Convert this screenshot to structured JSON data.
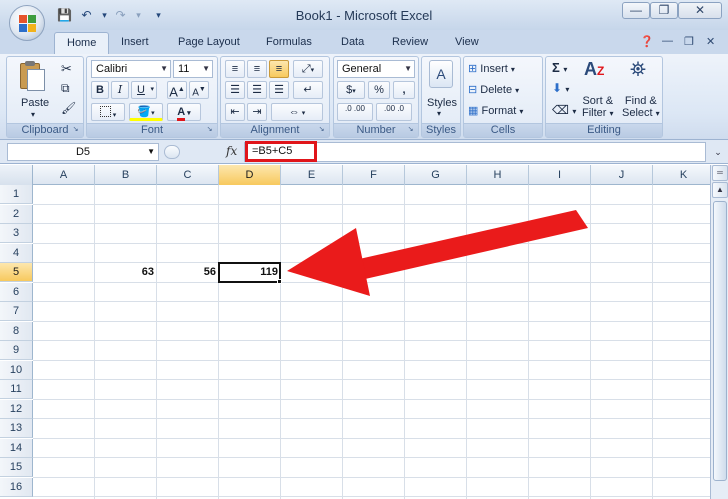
{
  "window": {
    "title": "Book1 - Microsoft Excel",
    "controls": {
      "minimize": "—",
      "restore": "❐",
      "close": "✕"
    }
  },
  "quick_access": {
    "save": "💾",
    "undo": "↶",
    "redo": "↷",
    "customize": "▾"
  },
  "tabs": [
    "Home",
    "Insert",
    "Page Layout",
    "Formulas",
    "Data",
    "Review",
    "View"
  ],
  "active_tab": "Home",
  "ribbon": {
    "clipboard": {
      "label": "Clipboard",
      "paste": "Paste"
    },
    "font": {
      "label": "Font",
      "family": "Calibri",
      "size": "11",
      "bold": "B",
      "italic": "I",
      "underline": "U",
      "grow": "A",
      "shrink": "A"
    },
    "alignment": {
      "label": "Alignment"
    },
    "number": {
      "label": "Number",
      "format": "General",
      "currency": "$",
      "percent": "%",
      "comma": ",",
      "inc_decimal": ".0 .00",
      "dec_decimal": ".00 .0"
    },
    "styles": {
      "label": "Styles",
      "button": "Styles"
    },
    "cells": {
      "label": "Cells",
      "insert": "Insert",
      "delete": "Delete",
      "format": "Format"
    },
    "editing": {
      "label": "Editing",
      "sort_filter_1": "Sort &",
      "sort_filter_2": "Filter",
      "find_select_1": "Find &",
      "find_select_2": "Select"
    }
  },
  "formula_bar": {
    "name_box": "D5",
    "fx": "fx",
    "formula": "=B5+C5"
  },
  "columns": [
    "A",
    "B",
    "C",
    "D",
    "E",
    "F",
    "G",
    "H",
    "I",
    "J",
    "K"
  ],
  "rows": [
    "1",
    "2",
    "3",
    "4",
    "5",
    "6",
    "7",
    "8",
    "9",
    "10",
    "11",
    "12",
    "13",
    "14",
    "15",
    "16"
  ],
  "selected": {
    "column": "D",
    "row": "5"
  },
  "cells": {
    "B5": "63",
    "C5": "56",
    "D5": "119"
  },
  "colors": {
    "accent": "#e0151a",
    "selection_header": "#f7c95e"
  }
}
